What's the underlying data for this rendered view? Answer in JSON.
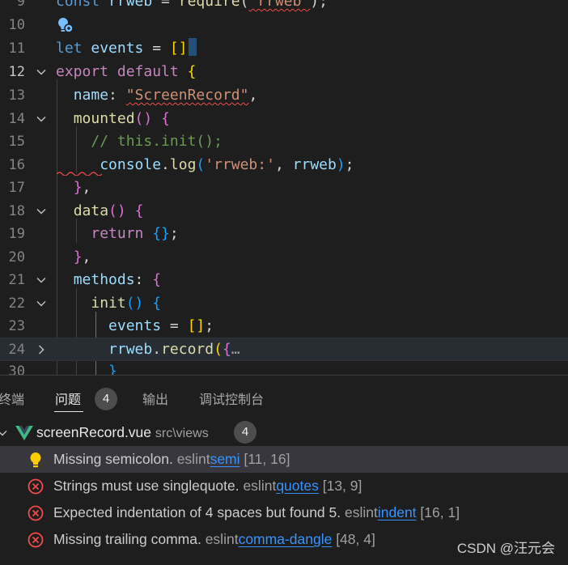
{
  "editor": {
    "lines": [
      {
        "num": "9",
        "tokens": [
          [
            "kw",
            "const "
          ],
          [
            "var",
            "rrweb"
          ],
          [
            "pun",
            " = "
          ],
          [
            "fn",
            "require"
          ],
          [
            "pun",
            "("
          ],
          [
            "str",
            "'rrweb'"
          ],
          [
            "pun",
            ");"
          ]
        ]
      },
      {
        "num": "10",
        "tokens": []
      },
      {
        "num": "11",
        "tokens": [
          [
            "kw",
            "let "
          ],
          [
            "var",
            "events"
          ],
          [
            "pun",
            " = "
          ],
          [
            "br",
            "[]"
          ]
        ]
      },
      {
        "num": "12",
        "tokens": [
          [
            "ctl",
            "export "
          ],
          [
            "ctl",
            "default "
          ],
          [
            "br",
            "{"
          ]
        ]
      },
      {
        "num": "13",
        "tokens": [
          [
            "pun",
            "  "
          ],
          [
            "var",
            "name"
          ],
          [
            "pun",
            ": "
          ],
          [
            "str",
            "\"ScreenRecord\""
          ],
          [
            "pun",
            ","
          ]
        ]
      },
      {
        "num": "14",
        "tokens": [
          [
            "pun",
            "  "
          ],
          [
            "fn",
            "mounted"
          ],
          [
            "br2",
            "()"
          ],
          [
            "pun",
            " "
          ],
          [
            "br2",
            "{"
          ]
        ]
      },
      {
        "num": "15",
        "tokens": [
          [
            "pun",
            "    "
          ],
          [
            "cmt",
            "// this.init();"
          ]
        ]
      },
      {
        "num": "16",
        "tokens": [
          [
            "pun",
            "     "
          ],
          [
            "var",
            "console"
          ],
          [
            "pun",
            "."
          ],
          [
            "fn",
            "log"
          ],
          [
            "br3",
            "("
          ],
          [
            "str",
            "'rrweb:'"
          ],
          [
            "pun",
            ", "
          ],
          [
            "var",
            "rrweb"
          ],
          [
            "br3",
            ")"
          ],
          [
            "pun",
            ";"
          ]
        ]
      },
      {
        "num": "17",
        "tokens": [
          [
            "pun",
            "  "
          ],
          [
            "br2",
            "}"
          ],
          [
            "pun",
            ","
          ]
        ]
      },
      {
        "num": "18",
        "tokens": [
          [
            "pun",
            "  "
          ],
          [
            "fn",
            "data"
          ],
          [
            "br2",
            "()"
          ],
          [
            "pun",
            " "
          ],
          [
            "br2",
            "{"
          ]
        ]
      },
      {
        "num": "19",
        "tokens": [
          [
            "pun",
            "    "
          ],
          [
            "ctl",
            "return "
          ],
          [
            "br3",
            "{}"
          ],
          [
            "pun",
            ";"
          ]
        ]
      },
      {
        "num": "20",
        "tokens": [
          [
            "pun",
            "  "
          ],
          [
            "br2",
            "}"
          ],
          [
            "pun",
            ","
          ]
        ]
      },
      {
        "num": "21",
        "tokens": [
          [
            "pun",
            "  "
          ],
          [
            "var",
            "methods"
          ],
          [
            "pun",
            ": "
          ],
          [
            "br2",
            "{"
          ]
        ]
      },
      {
        "num": "22",
        "tokens": [
          [
            "pun",
            "    "
          ],
          [
            "fn",
            "init"
          ],
          [
            "br3",
            "()"
          ],
          [
            "pun",
            " "
          ],
          [
            "br3",
            "{"
          ]
        ]
      },
      {
        "num": "23",
        "tokens": [
          [
            "pun",
            "      "
          ],
          [
            "var",
            "events"
          ],
          [
            "pun",
            " = "
          ],
          [
            "br",
            "[]"
          ],
          [
            "pun",
            ";"
          ]
        ]
      },
      {
        "num": "24",
        "tokens": [
          [
            "pun",
            "      "
          ],
          [
            "var",
            "rrweb"
          ],
          [
            "pun",
            "."
          ],
          [
            "fn",
            "record"
          ],
          [
            "br",
            "("
          ],
          [
            "br2",
            "{"
          ],
          [
            "ell",
            "…"
          ]
        ]
      },
      {
        "num": "30",
        "tokens": [
          [
            "pun",
            "      "
          ],
          [
            "br3",
            "}"
          ]
        ]
      }
    ]
  },
  "panel": {
    "tabs": {
      "terminal": "终端",
      "problems": "问题",
      "problems_count": "4",
      "output": "输出",
      "debug_console": "调试控制台"
    },
    "file": {
      "name": "screenRecord.vue",
      "path": "src\\views",
      "count": "4"
    },
    "problems": [
      {
        "severity": "warning",
        "message": "Missing semicolon.",
        "source": "eslint",
        "rule": "semi",
        "position": "[11, 16]"
      },
      {
        "severity": "error",
        "message": "Strings must use singlequote.",
        "source": "eslint",
        "rule": "quotes",
        "position": "[13, 9]"
      },
      {
        "severity": "error",
        "message": "Expected indentation of 4 spaces but found 5.",
        "source": "eslint",
        "rule": "indent",
        "position": "[16, 1]"
      },
      {
        "severity": "error",
        "message": "Missing trailing comma.",
        "source": "eslint",
        "rule": "comma-dangle",
        "position": "[48, 4]"
      }
    ]
  },
  "watermark": "CSDN @汪元会",
  "colors": {
    "accent_link": "#3794ff",
    "error": "#f14c4c",
    "warning": "#ffcc00",
    "vue_green": "#41b883"
  }
}
